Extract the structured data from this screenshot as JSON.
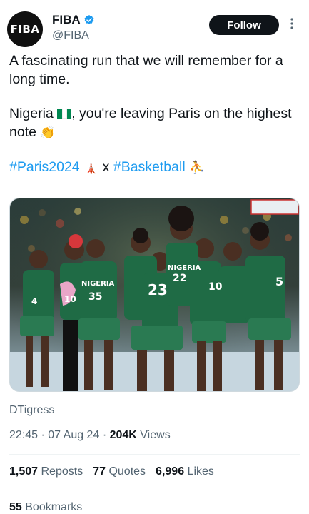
{
  "account": {
    "avatar_text": "FIBA",
    "name": "FIBA",
    "handle": "@FIBA",
    "verified": true,
    "follow_label": "Follow",
    "more_icon": "more-vertical-icon"
  },
  "tweet": {
    "line1": "A fascinating run that we will remember for a long time.",
    "line2_a": "Nigeria ",
    "flag_emoji": "nigeria-flag-emoji",
    "line2_b": ", you're leaving Paris on the highest note ",
    "clap_emoji": "👏",
    "hashtag1": "#Paris2024",
    "tower_emoji": "🗼",
    "x_text": " x ",
    "hashtag2": "#Basketball",
    "player_emoji": "⛹"
  },
  "media": {
    "jersey_text": "NIGERIA",
    "numbers": [
      "4",
      "10",
      "35",
      "23",
      "22",
      "10",
      "5"
    ]
  },
  "caption": "DTigress",
  "meta": {
    "time": "22:45",
    "date": "07 Aug 24",
    "views_count": "204K",
    "views_label": "Views"
  },
  "stats": {
    "reposts_count": "1,507",
    "reposts_label": "Reposts",
    "quotes_count": "77",
    "quotes_label": "Quotes",
    "likes_count": "6,996",
    "likes_label": "Likes",
    "bookmarks_count": "55",
    "bookmarks_label": "Bookmarks"
  },
  "colors": {
    "link": "#1d9bf0",
    "muted": "#536471",
    "text": "#0f1419",
    "jersey_green": "#1f6b45",
    "flag_green": "#008751"
  }
}
